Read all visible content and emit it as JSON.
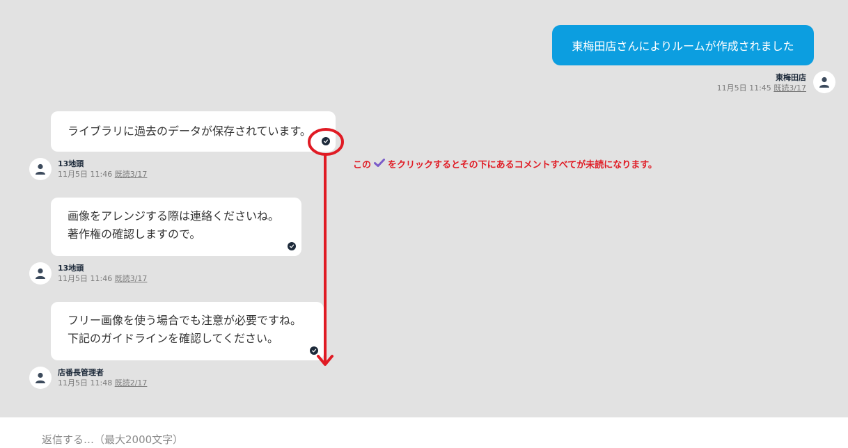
{
  "room": {
    "created_message": "東梅田店さんによりルームが作成されました",
    "created_sender": "東梅田店",
    "created_time": "11月5日 11:45",
    "created_read": "既読3/17"
  },
  "messages": [
    {
      "text": "ライブラリに過去のデータが保存されています。",
      "sender": "13地頭",
      "time": "11月5日 11:46",
      "read": "既読3/17"
    },
    {
      "text_line1": "画像をアレンジする際は連絡くださいね。",
      "text_line2": "著作権の確認しますので。",
      "sender": "13地頭",
      "time": "11月5日 11:46",
      "read": "既読3/17"
    },
    {
      "text_line1": "フリー画像を使う場合でも注意が必要ですね。",
      "text_line2": "下記のガイドラインを確認してください。",
      "sender": "店番長管理者",
      "time": "11月5日 11:48",
      "read": "既読2/17"
    }
  ],
  "annotation": {
    "prefix": "この",
    "suffix": "をクリックするとその下にあるコメントすべてが未読になります。",
    "color": "#e01b24"
  },
  "reply": {
    "placeholder": "返信する…（最大2000文字）"
  },
  "colors": {
    "accent": "#0c9ee0",
    "check": "#1d2a3a",
    "background": "#e2e2e2"
  },
  "icons": {
    "avatar": "user-avatar-icon",
    "check": "read-check-icon"
  }
}
